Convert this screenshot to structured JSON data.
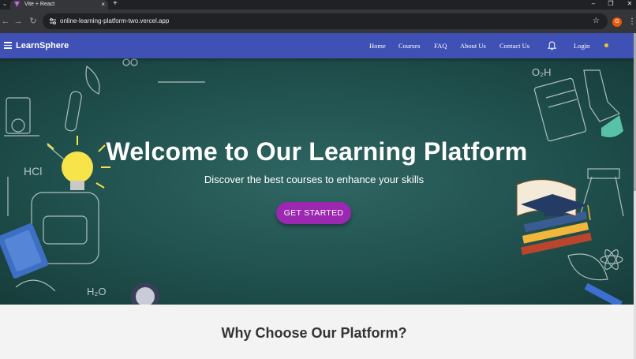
{
  "browser": {
    "tab_title": "Vite + React",
    "tab_close_glyph": "×",
    "new_tab_glyph": "+",
    "tab_list_glyph": "⌄",
    "url": "online-learning-platform-two.vercel.app",
    "profile_initial": "G",
    "window_controls": {
      "minimize": "–",
      "restore": "❐",
      "close": "✕"
    },
    "nav_glyphs": {
      "back": "←",
      "forward": "→",
      "reload": "↻"
    },
    "star_glyph": "☆",
    "menu_glyph": "⋮"
  },
  "appbar": {
    "brand": "LearnSphere",
    "nav": [
      {
        "label": "Home"
      },
      {
        "label": "Courses"
      },
      {
        "label": "FAQ"
      },
      {
        "label": "About Us"
      },
      {
        "label": "Contact Us"
      }
    ],
    "login_label": "Login",
    "color": "#3f51b5"
  },
  "hero": {
    "title": "Welcome to Our Learning Platform",
    "subtitle": "Discover the best courses to enhance your skills",
    "cta_label": "GET STARTED",
    "cta_color": "#9c27b0",
    "chalk_labels": {
      "formula_left": "HCl",
      "formula_top": "O₂H",
      "formula_bottom": "H₂O"
    }
  },
  "section": {
    "why_title": "Why Choose Our Platform?"
  },
  "icons": {
    "menu": "hamburger-icon",
    "notifications": "bell-icon",
    "site_info": "tune-icon"
  }
}
